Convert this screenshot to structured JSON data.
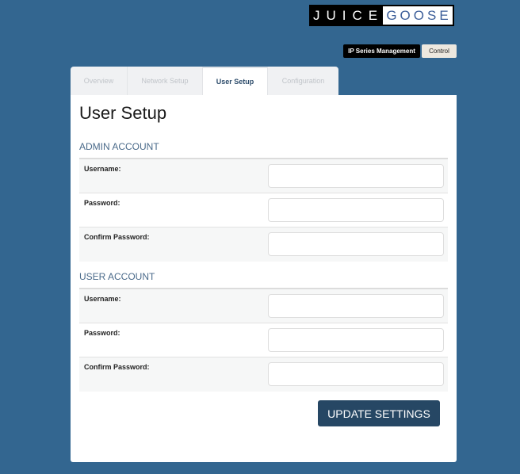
{
  "brand": {
    "left": "JUICE",
    "right": "GOOSE"
  },
  "top_buttons": {
    "ip_series": "IP Series Management",
    "control": "Control"
  },
  "tabs": [
    {
      "label": "Overview",
      "active": false
    },
    {
      "label": "Network Setup",
      "active": false
    },
    {
      "label": "User Setup",
      "active": true
    },
    {
      "label": "Configuration",
      "active": false
    }
  ],
  "page": {
    "title": "User Setup",
    "admin": {
      "heading": "ADMIN ACCOUNT",
      "fields": [
        {
          "label": "Username:",
          "value": ""
        },
        {
          "label": "Password:",
          "value": ""
        },
        {
          "label": "Confirm Password:",
          "value": ""
        }
      ]
    },
    "user": {
      "heading": "USER ACCOUNT",
      "fields": [
        {
          "label": "Username:",
          "value": ""
        },
        {
          "label": "Password:",
          "value": ""
        },
        {
          "label": "Confirm Password:",
          "value": ""
        }
      ]
    },
    "update_button": "UPDATE SETTINGS"
  },
  "colors": {
    "background": "#336690",
    "accent": "#264764"
  }
}
